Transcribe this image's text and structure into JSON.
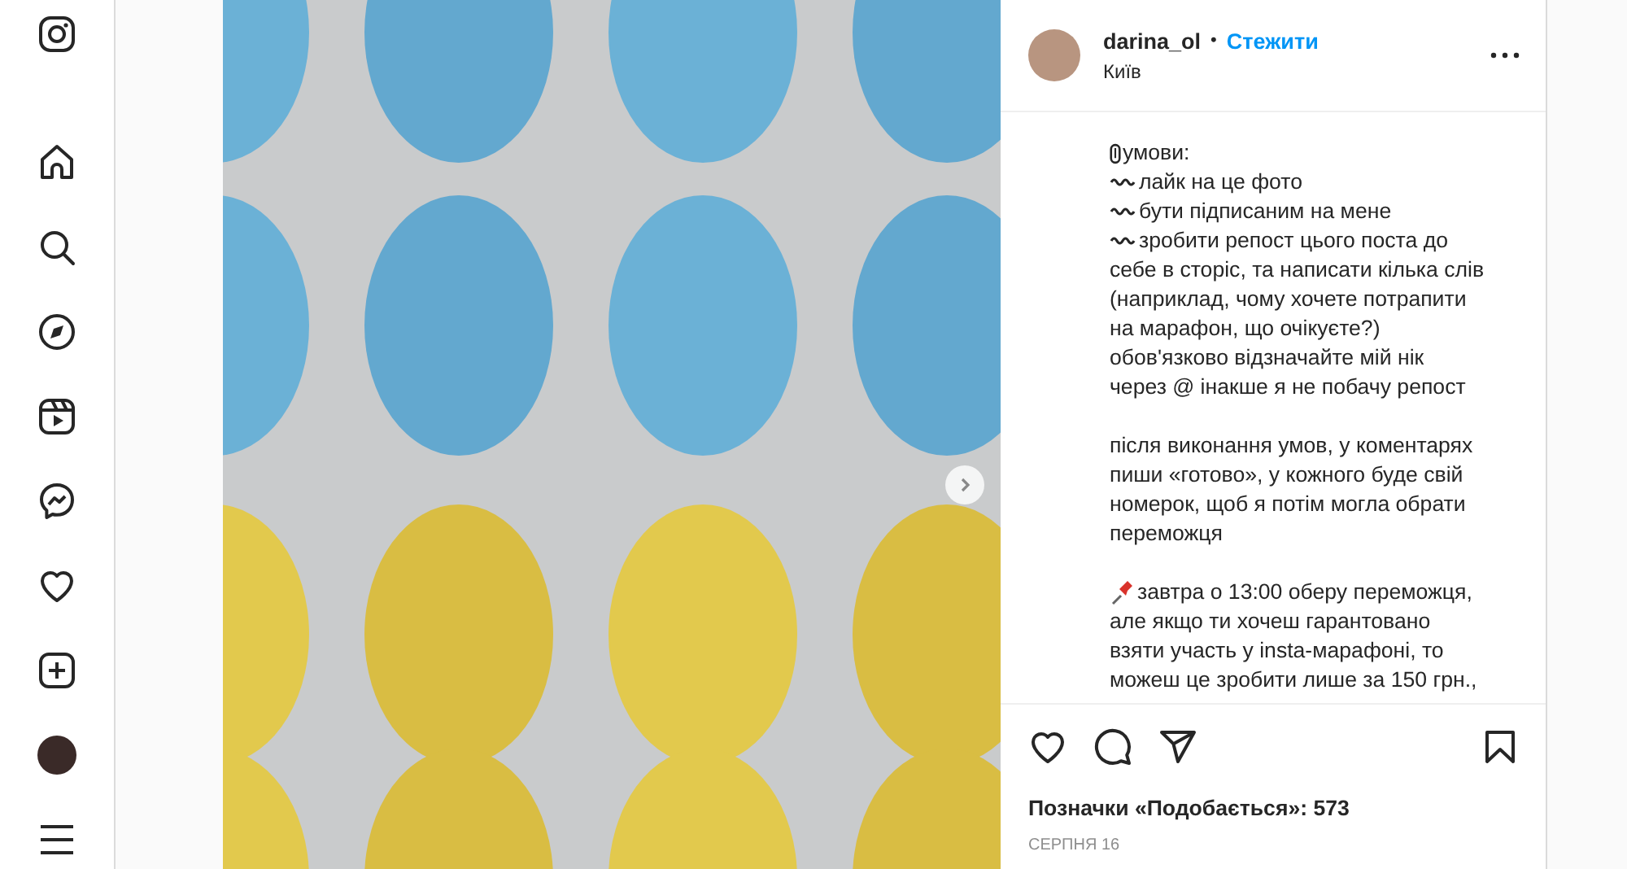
{
  "sidebar": {
    "items": [
      {
        "kind": "home",
        "selected": false
      },
      {
        "kind": "search",
        "selected": false
      },
      {
        "kind": "explore",
        "selected": false
      },
      {
        "kind": "reels",
        "selected": false
      },
      {
        "kind": "messages",
        "selected": false
      },
      {
        "kind": "notifications",
        "selected": false
      },
      {
        "kind": "create",
        "selected": false
      },
      {
        "kind": "profile",
        "selected": false
      },
      {
        "kind": "more",
        "selected": false
      }
    ]
  },
  "post": {
    "author": "darina_ol",
    "separator": "•",
    "follow": "Стежити",
    "location": "Київ",
    "caption": [
      {
        "kind": "clip",
        "text": "умови:"
      },
      {
        "kind": "wave",
        "text": "лайк на це фото"
      },
      {
        "kind": "wave",
        "text": "бути підписаним на мене"
      },
      {
        "kind": "wave",
        "text": "зробити репост цього поста до"
      },
      {
        "kind": "line",
        "text": "себе в сторіс, та написати кілька слів"
      },
      {
        "kind": "line",
        "text": "(наприклад, чому хочете потрапити"
      },
      {
        "kind": "line",
        "text": "на марафон, що очікуєте?)"
      },
      {
        "kind": "line",
        "text": "обов'язково відзначайте мій нік"
      },
      {
        "kind": "line",
        "text": "через @ інакше я не побачу репост"
      },
      {
        "kind": "gap"
      },
      {
        "kind": "line",
        "text": "після виконання умов, у коментарях"
      },
      {
        "kind": "line",
        "text": "пиши «готово», у кожного буде свій"
      },
      {
        "kind": "line",
        "text": "номерок, щоб я потім могла обрати"
      },
      {
        "kind": "line",
        "text": "переможця"
      },
      {
        "kind": "gap"
      },
      {
        "kind": "pin",
        "text": "завтра о 13:00 оберу переможця,"
      },
      {
        "kind": "line",
        "text": "але якщо ти хочеш гарантовано"
      },
      {
        "kind": "line",
        "text": "взяти участь у insta-марафоні, то"
      },
      {
        "kind": "line",
        "text": "можеш це зробити лише за 150 грн.,"
      }
    ],
    "likes": "Позначки «Подобається»: 573",
    "date": "СЕРПНЯ 16"
  }
}
